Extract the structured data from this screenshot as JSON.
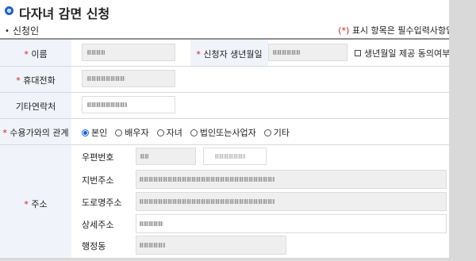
{
  "header": {
    "title": "다자녀 감면 신청",
    "section_label": "신청인",
    "required_note_mark": "(*)",
    "required_note_text": " 표시 항목은 필수입력사항입니다."
  },
  "form": {
    "required_mark": "*",
    "name_label": "이름",
    "birth_label": "신청자 생년월일",
    "birth_consent_label": "생년월일 제공 동의여부",
    "mobile_label": "휴대전화",
    "other_contact_label": "기타연락처",
    "relation_label": "수용가와의 관계",
    "relation_options": [
      "본인",
      "배우자",
      "자녀",
      "법인또는사업자",
      "기타"
    ],
    "relation_selected": "본인",
    "address_label": "주소",
    "zip_label": "우편번호",
    "jibun_label": "지번주소",
    "road_label": "도로명주소",
    "detail_label": "상세주소",
    "admin_dong_label": "행정동"
  }
}
